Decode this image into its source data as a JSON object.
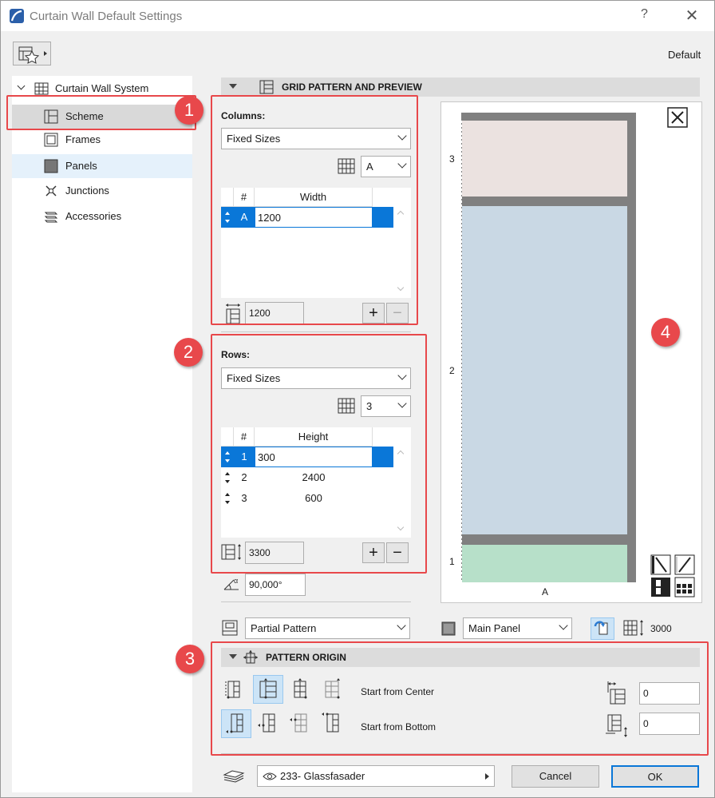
{
  "window": {
    "title": "Curtain Wall Default Settings",
    "help": "?",
    "close": "✕",
    "default_label": "Default"
  },
  "tree": {
    "root": "Curtain Wall System",
    "items": [
      {
        "label": "Scheme"
      },
      {
        "label": "Frames"
      },
      {
        "label": "Panels"
      },
      {
        "label": "Junctions"
      },
      {
        "label": "Accessories"
      }
    ]
  },
  "grid_section": {
    "title": "GRID PATTERN AND PREVIEW"
  },
  "columns": {
    "label": "Columns:",
    "mode": "Fixed Sizes",
    "selector": "A",
    "headers": [
      "#",
      "Width"
    ],
    "rows": [
      {
        "id": "A",
        "value": "1200"
      }
    ],
    "total": "1200"
  },
  "rows": {
    "label": "Rows:",
    "mode": "Fixed Sizes",
    "selector": "3",
    "headers": [
      "#",
      "Height"
    ],
    "rows": [
      {
        "id": "1",
        "value": "300"
      },
      {
        "id": "2",
        "value": "2400"
      },
      {
        "id": "3",
        "value": "600"
      }
    ],
    "total": "3300"
  },
  "angle": "90,000°",
  "preview": {
    "row_labels": [
      "3",
      "2",
      "1"
    ],
    "col_label": "A",
    "colors": {
      "top": "#ebe2e0",
      "middle": "#c9d8e4",
      "bottom": "#b7e0c9",
      "frame": "#808080"
    }
  },
  "pattern": {
    "mode": "Partial Pattern",
    "panel": "Main Panel",
    "height": "3000"
  },
  "origin": {
    "title": "PATTERN ORIGIN",
    "h_label": "Start from Center",
    "v_label": "Start from Bottom",
    "h_offset": "0",
    "v_offset": "0"
  },
  "footer": {
    "layer": "233- Glassfasader",
    "cancel": "Cancel",
    "ok": "OK"
  },
  "badges": [
    "1",
    "2",
    "3",
    "4"
  ],
  "accent": "#e8484b"
}
